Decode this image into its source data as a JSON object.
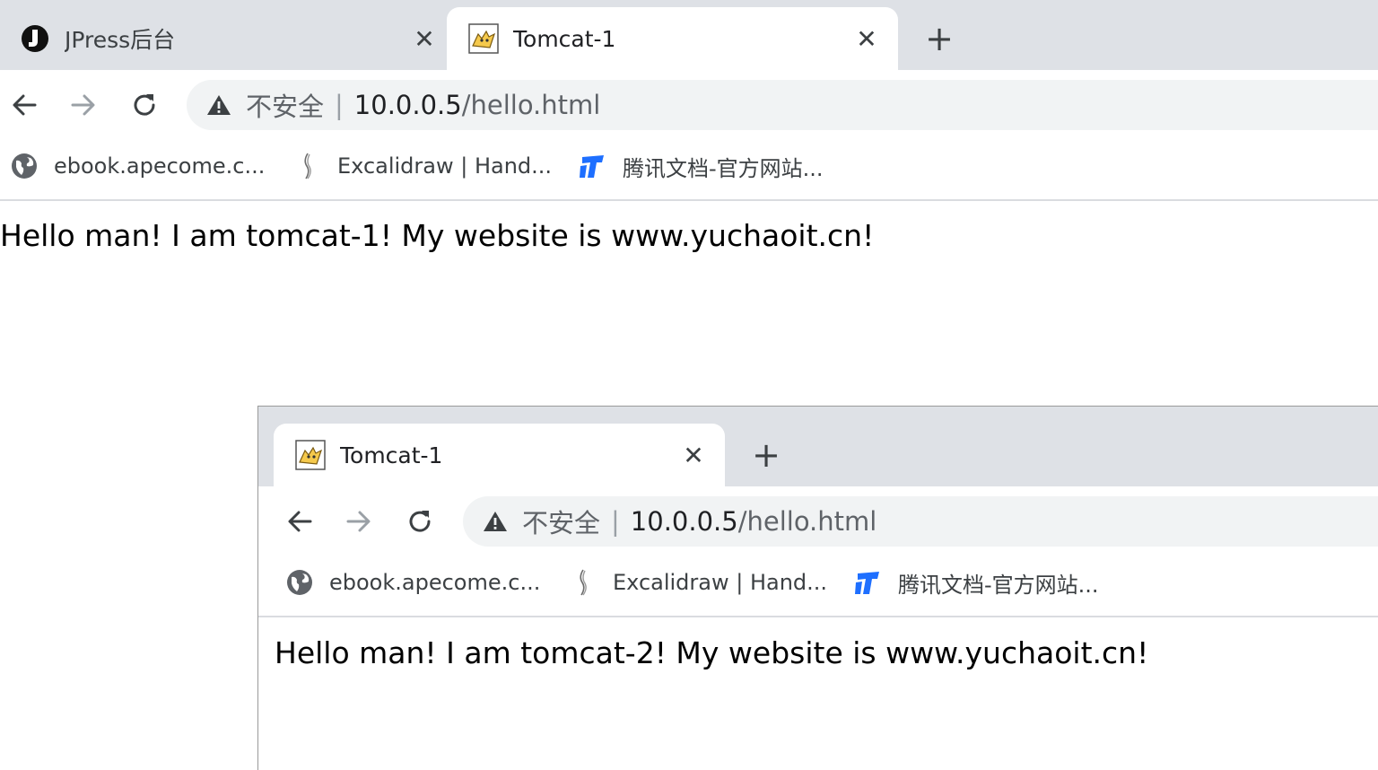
{
  "window1": {
    "tabs": [
      {
        "title": "JPress后台",
        "icon": "jpress-logo-icon",
        "active": false
      },
      {
        "title": "Tomcat-1",
        "icon": "tomcat-icon",
        "active": true
      }
    ],
    "omnibox": {
      "security_label": "不安全",
      "url_host": "10.0.0.5",
      "url_path": "/hello.html"
    },
    "bookmarks": [
      {
        "label": "ebook.apecome.c...",
        "icon": "globe-icon"
      },
      {
        "label": "Excalidraw | Hand...",
        "icon": "excalidraw-icon"
      },
      {
        "label": "腾讯文档-官方网站...",
        "icon": "tencent-docs-icon"
      }
    ],
    "page_text": "Hello man! I am tomcat-1! My website is www.yuchaoit.cn!"
  },
  "window2": {
    "tabs": [
      {
        "title": "Tomcat-1",
        "icon": "tomcat-icon",
        "active": true
      }
    ],
    "omnibox": {
      "security_label": "不安全",
      "url_host": "10.0.0.5",
      "url_path": "/hello.html"
    },
    "bookmarks": [
      {
        "label": "ebook.apecome.c...",
        "icon": "globe-icon"
      },
      {
        "label": "Excalidraw | Hand...",
        "icon": "excalidraw-icon"
      },
      {
        "label": "腾讯文档-官方网站...",
        "icon": "tencent-docs-icon"
      }
    ],
    "page_text": "Hello man! I am tomcat-2! My website is www.yuchaoit.cn!"
  },
  "colors": {
    "tabstrip": "#dee1e6",
    "omnibox": "#f1f3f4",
    "tencent_blue": "#1e6fff",
    "tomcat_yellow": "#f5c94c"
  }
}
